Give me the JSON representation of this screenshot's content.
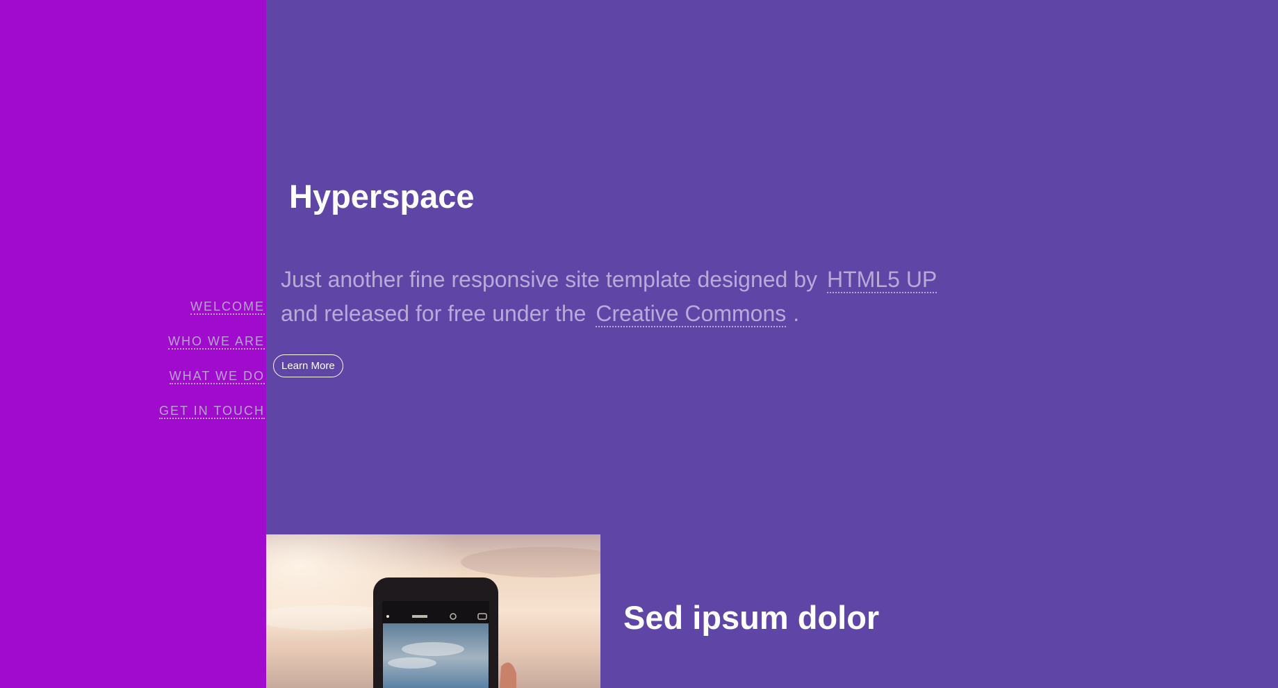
{
  "nav": {
    "items": [
      {
        "label": "Welcome"
      },
      {
        "label": "Who we are"
      },
      {
        "label": "What we do"
      },
      {
        "label": "Get in touch"
      }
    ]
  },
  "hero": {
    "title": "Hyperspace",
    "text_before": "Just another fine responsive site template designed by",
    "link1": "HTML5 UP",
    "text_middle": "and released for free under the",
    "link2": "Creative Commons",
    "text_after": ".",
    "button_label": "Learn More"
  },
  "spotlight": {
    "title": "Sed ipsum dolor",
    "image_subject": "phone-photographing-sky"
  },
  "colors": {
    "sidebar": "#a00bcd",
    "main": "#5e45a6",
    "text_muted": "#b9abd7",
    "heading": "#ffffff"
  }
}
